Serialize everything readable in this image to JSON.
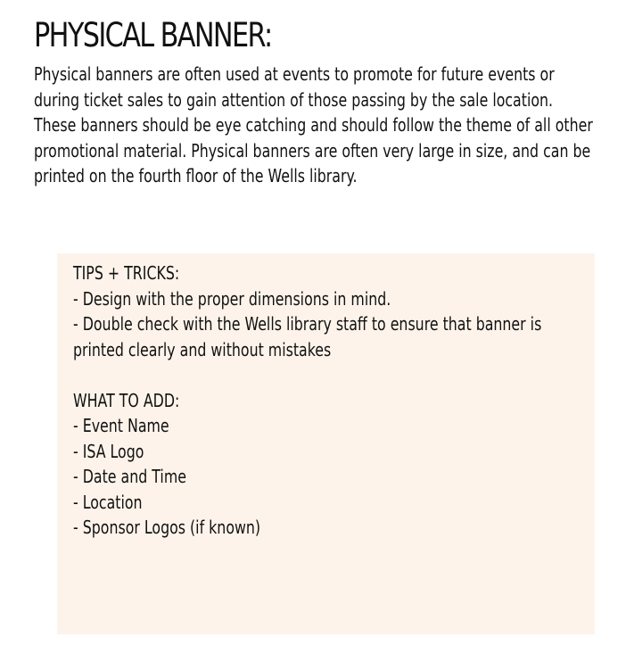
{
  "document": {
    "title": "PHYSICAL BANNER:",
    "intro_lines": [
      "Physical banners are often used at events to promote for future events or",
      "during ticket sales to gain attention of those passing by the sale location.",
      "These banners should be eye catching and should follow the theme of all other",
      "promotional material. Physical banners are often very large in size, and can be",
      "printed on the fourth floor of the Wells library."
    ]
  },
  "tips": {
    "heading": "TIPS + TRICKS:",
    "items": [
      "- Design with the proper dimensions in mind.",
      "- Double check with the Wells library staff to ensure that banner is",
      "printed clearly and without mistakes"
    ]
  },
  "what_to_add": {
    "heading": "WHAT TO ADD:",
    "items": [
      "- Event Name",
      "- ISA Logo",
      "- Date and Time",
      "- Location",
      "- Sponsor Logos (if known)"
    ]
  },
  "colors": {
    "panel_background": "#fdf3ea",
    "text": "#111111"
  }
}
